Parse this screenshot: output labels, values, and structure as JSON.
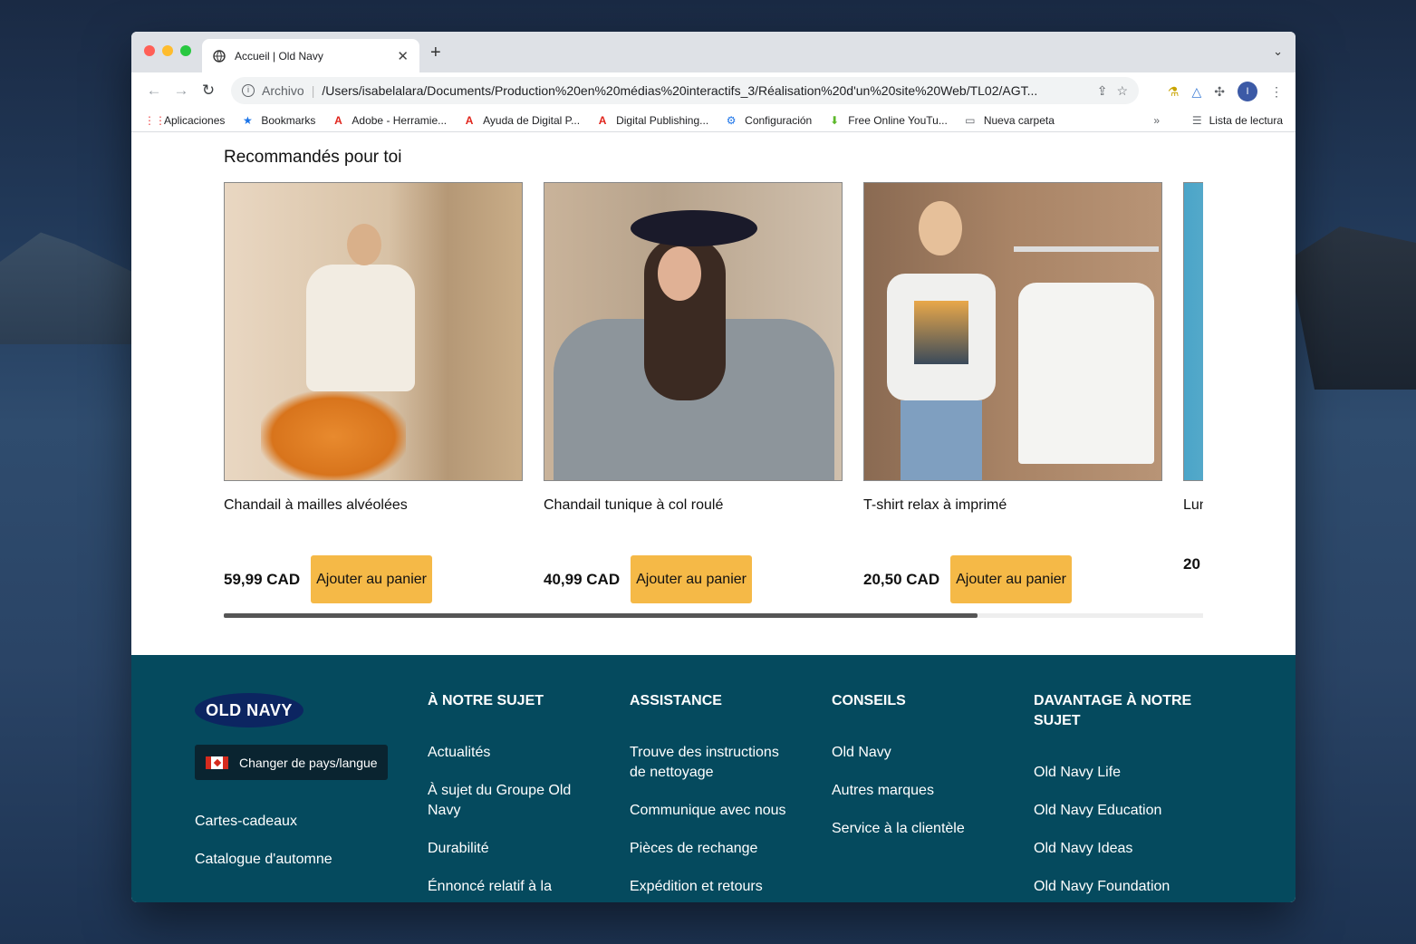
{
  "browser": {
    "tab_title": "Accueil | Old Navy",
    "new_tab": "+",
    "url_scheme": "Archivo",
    "url": "/Users/isabelalara/Documents/Production%20en%20médias%20interactifs_3/Réalisation%20d'un%20site%20Web/TL02/AGT...",
    "avatar_letter": "I",
    "bookmarks": [
      {
        "label": "Aplicaciones",
        "icon": "apps-grid-icon"
      },
      {
        "label": "Bookmarks",
        "icon": "star-icon"
      },
      {
        "label": "Adobe - Herramie...",
        "icon": "adobe-icon"
      },
      {
        "label": "Ayuda de Digital P...",
        "icon": "adobe-icon"
      },
      {
        "label": "Digital Publishing...",
        "icon": "adobe-icon"
      },
      {
        "label": "Configuración",
        "icon": "gear-icon"
      },
      {
        "label": "Free Online YouTu...",
        "icon": "download-icon"
      },
      {
        "label": "Nueva carpeta",
        "icon": "folder-icon"
      }
    ],
    "more": "»",
    "reading_list": "Lista de lectura"
  },
  "recommendations": {
    "title": "Recommandés pour toi",
    "products": [
      {
        "name": "Chandail à mailles alvéolées",
        "price": "59,99 CAD",
        "button": "Ajouter au panier"
      },
      {
        "name": "Chandail tunique à col roulé",
        "price": "40,99 CAD",
        "button": "Ajouter au panier"
      },
      {
        "name": "T-shirt relax à imprimé",
        "price": "20,50 CAD",
        "button": "Ajouter au panier"
      },
      {
        "name": "Lun",
        "price": "20",
        "button": ""
      }
    ],
    "scroll_progress": 0.77
  },
  "footer": {
    "logo": "OLD NAVY",
    "country_button": "Changer de pays/langue",
    "left_links": [
      "Cartes-cadeaux",
      "Catalogue d'automne"
    ],
    "columns": [
      {
        "heading": "À NOTRE SUJET",
        "links": [
          "Actualités",
          "À sujet du Groupe Old Navy",
          "Durabilité",
          "Énnoncé relatif à la"
        ]
      },
      {
        "heading": "ASSISTANCE",
        "links": [
          "Trouve des instructions de nettoyage",
          "Communique avec nous",
          "Pièces de rechange",
          "Expédition et retours"
        ]
      },
      {
        "heading": "CONSEILS",
        "links": [
          "Old Navy",
          "Autres marques",
          "Service à la clientèle"
        ]
      },
      {
        "heading": "DAVANTAGE À NOTRE SUJET",
        "links": [
          "Old Navy Life",
          "Old Navy Education",
          "Old Navy Ideas",
          "Old Navy Foundation"
        ]
      }
    ]
  },
  "colors": {
    "footer_bg": "#054a5e",
    "cart_button": "#f5b947",
    "logo_bg": "#0c2561"
  }
}
